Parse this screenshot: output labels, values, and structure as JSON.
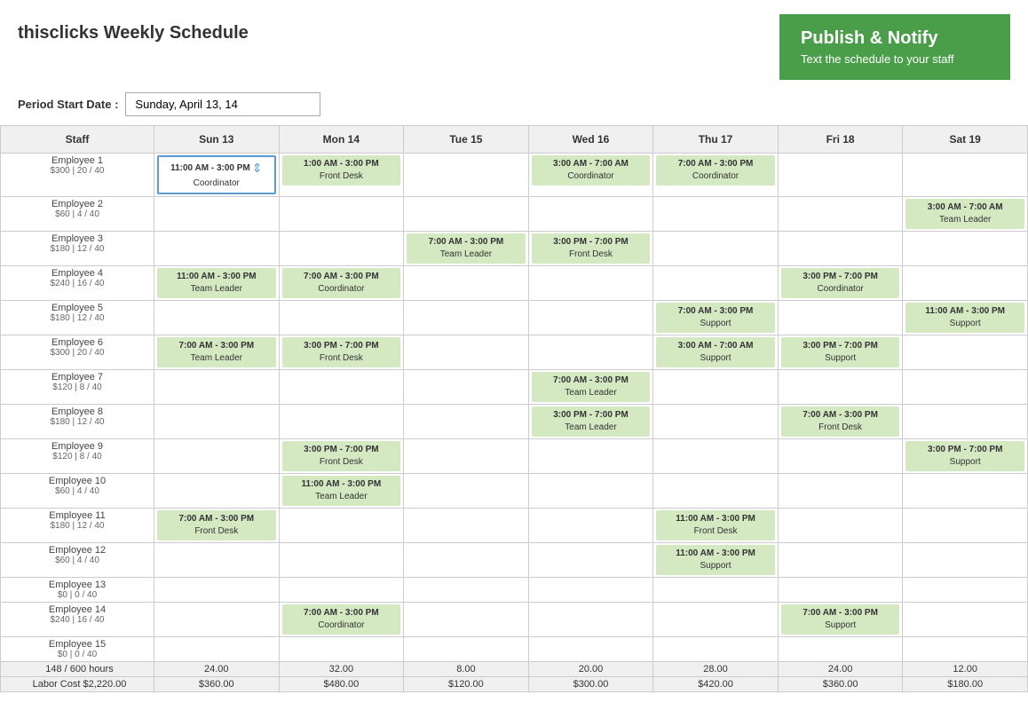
{
  "header": {
    "title": "thisclicks Weekly Schedule",
    "publish_title": "Publish & Notify",
    "publish_sub": "Text the schedule to your staff"
  },
  "period": {
    "label": "Period Start Date :",
    "value": "Sunday, April 13, 14"
  },
  "days": [
    {
      "label": "Staff"
    },
    {
      "label": "Sun 13"
    },
    {
      "label": "Mon 14"
    },
    {
      "label": "Tue 15"
    },
    {
      "label": "Wed 16"
    },
    {
      "label": "Thu 17"
    },
    {
      "label": "Fri 18"
    },
    {
      "label": "Sat 19"
    }
  ],
  "employees": [
    {
      "name": "Employee 1",
      "info": "$300 | 20 / 40",
      "sun": {
        "time": "11:00 AM - 3:00 PM",
        "role": "Coordinator",
        "editing": true
      },
      "mon": {
        "time": "1:00 AM - 3:00 PM",
        "role": "Front Desk"
      },
      "tue": null,
      "wed": {
        "time": "3:00 AM - 7:00 AM",
        "role": "Coordinator"
      },
      "thu": {
        "time": "7:00 AM - 3:00 PM",
        "role": "Coordinator"
      },
      "fri": null,
      "sat": null
    },
    {
      "name": "Employee 2",
      "info": "$60 | 4 / 40",
      "sun": null,
      "mon": null,
      "tue": null,
      "wed": null,
      "thu": null,
      "fri": null,
      "sat": {
        "time": "3:00 AM - 7:00 AM",
        "role": "Team Leader"
      }
    },
    {
      "name": "Employee 3",
      "info": "$180 | 12 / 40",
      "sun": null,
      "mon": null,
      "tue": {
        "time": "7:00 AM - 3:00 PM",
        "role": "Team Leader"
      },
      "wed": {
        "time": "3:00 PM - 7:00 PM",
        "role": "Front Desk"
      },
      "thu": null,
      "fri": null,
      "sat": null
    },
    {
      "name": "Employee 4",
      "info": "$240 | 16 / 40",
      "sun": {
        "time": "11:00 AM - 3:00 PM",
        "role": "Team Leader"
      },
      "mon": {
        "time": "7:00 AM - 3:00 PM",
        "role": "Coordinator"
      },
      "tue": null,
      "wed": null,
      "thu": null,
      "fri": {
        "time": "3:00 PM - 7:00 PM",
        "role": "Coordinator"
      },
      "sat": null
    },
    {
      "name": "Employee 5",
      "info": "$180 | 12 / 40",
      "sun": null,
      "mon": null,
      "tue": null,
      "wed": null,
      "thu": {
        "time": "7:00 AM - 3:00 PM",
        "role": "Support"
      },
      "fri": null,
      "sat": {
        "time": "11:00 AM - 3:00 PM",
        "role": "Support"
      }
    },
    {
      "name": "Employee 6",
      "info": "$300 | 20 / 40",
      "sun": {
        "time": "7:00 AM - 3:00 PM",
        "role": "Team Leader"
      },
      "mon": {
        "time": "3:00 PM - 7:00 PM",
        "role": "Front Desk"
      },
      "tue": null,
      "wed": null,
      "thu": {
        "time": "3:00 AM - 7:00 AM",
        "role": "Support"
      },
      "fri": {
        "time": "3:00 PM - 7:00 PM",
        "role": "Support"
      },
      "sat": null
    },
    {
      "name": "Employee 7",
      "info": "$120 | 8 / 40",
      "sun": null,
      "mon": null,
      "tue": null,
      "wed": {
        "time": "7:00 AM - 3:00 PM",
        "role": "Team Leader"
      },
      "thu": null,
      "fri": null,
      "sat": null
    },
    {
      "name": "Employee 8",
      "info": "$180 | 12 / 40",
      "sun": null,
      "mon": null,
      "tue": null,
      "wed": {
        "time": "3:00 PM - 7:00 PM",
        "role": "Team Leader"
      },
      "thu": null,
      "fri": {
        "time": "7:00 AM - 3:00 PM",
        "role": "Front Desk"
      },
      "sat": null
    },
    {
      "name": "Employee 9",
      "info": "$120 | 8 / 40",
      "sun": null,
      "mon": {
        "time": "3:00 PM - 7:00 PM",
        "role": "Front Desk"
      },
      "tue": null,
      "wed": null,
      "thu": null,
      "fri": null,
      "sat": {
        "time": "3:00 PM - 7:00 PM",
        "role": "Support"
      }
    },
    {
      "name": "Employee 10",
      "info": "$60 | 4 / 40",
      "sun": null,
      "mon": {
        "time": "11:00 AM - 3:00 PM",
        "role": "Team Leader"
      },
      "tue": null,
      "wed": null,
      "thu": null,
      "fri": null,
      "sat": null
    },
    {
      "name": "Employee 11",
      "info": "$180 | 12 / 40",
      "sun": {
        "time": "7:00 AM - 3:00 PM",
        "role": "Front Desk"
      },
      "mon": null,
      "tue": null,
      "wed": null,
      "thu": {
        "time": "11:00 AM - 3:00 PM",
        "role": "Front Desk"
      },
      "fri": null,
      "sat": null
    },
    {
      "name": "Employee 12",
      "info": "$60 | 4 / 40",
      "sun": null,
      "mon": null,
      "tue": null,
      "wed": null,
      "thu": {
        "time": "11:00 AM - 3:00 PM",
        "role": "Support"
      },
      "fri": null,
      "sat": null
    },
    {
      "name": "Employee 13",
      "info": "$0 | 0 / 40",
      "sun": null,
      "mon": null,
      "tue": null,
      "wed": null,
      "thu": null,
      "fri": null,
      "sat": null
    },
    {
      "name": "Employee 14",
      "info": "$240 | 16 / 40",
      "sun": null,
      "mon": {
        "time": "7:00 AM - 3:00 PM",
        "role": "Coordinator"
      },
      "tue": null,
      "wed": null,
      "thu": null,
      "fri": {
        "time": "7:00 AM - 3:00 PM",
        "role": "Support"
      },
      "sat": null
    },
    {
      "name": "Employee 15",
      "info": "$0 | 0 / 40",
      "sun": null,
      "mon": null,
      "tue": null,
      "wed": null,
      "thu": null,
      "fri": null,
      "sat": null
    }
  ],
  "totals": {
    "label_hours": "148 / 600 hours",
    "label_cost": "Labor Cost $2,220.00",
    "sun_hours": "24.00",
    "mon_hours": "32.00",
    "tue_hours": "8.00",
    "wed_hours": "20.00",
    "thu_hours": "28.00",
    "fri_hours": "24.00",
    "sat_hours": "12.00",
    "sun_cost": "$360.00",
    "mon_cost": "$480.00",
    "tue_cost": "$120.00",
    "wed_cost": "$300.00",
    "thu_cost": "$420.00",
    "fri_cost": "$360.00",
    "sat_cost": "$180.00"
  }
}
